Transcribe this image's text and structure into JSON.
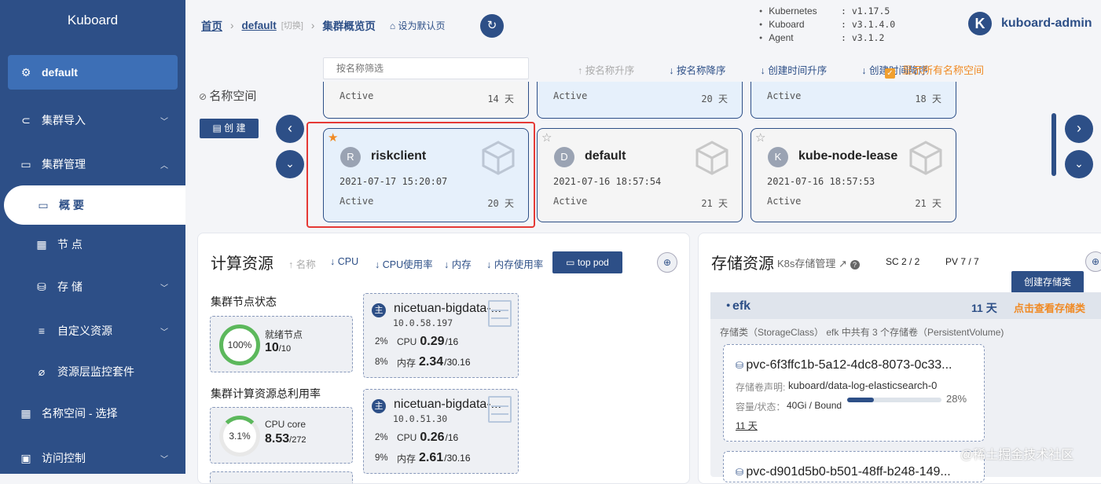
{
  "sidebar": {
    "brand": "Kuboard",
    "current_cluster": "default",
    "items": [
      {
        "label": "集群导入"
      },
      {
        "label": "集群管理"
      },
      {
        "label": "概 要"
      },
      {
        "label": "节 点"
      },
      {
        "label": "存 储"
      },
      {
        "label": "自定义资源"
      },
      {
        "label": "资源层监控套件"
      },
      {
        "label": "名称空间 - 选择"
      },
      {
        "label": "访问控制"
      }
    ]
  },
  "header": {
    "breadcrumb": {
      "home": "首页",
      "cluster": "default",
      "switch": "[切换]",
      "page": "集群概览页"
    },
    "set_default": "设为默认页",
    "versions": [
      {
        "name": "Kubernetes",
        "value": ": v1.17.5"
      },
      {
        "name": "Kuboard",
        "value": ": v3.1.4.0"
      },
      {
        "name": "Agent",
        "value": ": v3.1.2"
      }
    ],
    "user": {
      "initial": "K",
      "name": "kuboard-admin"
    }
  },
  "namespaces": {
    "label": "名称空间",
    "create_label": "创 建",
    "filter_placeholder": "按名称筛选",
    "sort": {
      "name_asc": "按名称升序",
      "name_desc": "按名称降序",
      "time_asc": "创建时间升序",
      "time_desc": "创建时间降序"
    },
    "show_all": "显示所有名称空间",
    "top_row": [
      {
        "status": "Active",
        "days": "14 天"
      },
      {
        "status": "Active",
        "days": "20 天"
      },
      {
        "status": "Active",
        "days": "18 天"
      }
    ],
    "cards": [
      {
        "initial": "R",
        "name": "riskclient",
        "created": "2021-07-17 15:20:07",
        "status": "Active",
        "days": "20 天",
        "starred": true
      },
      {
        "initial": "D",
        "name": "default",
        "created": "2021-07-16 18:57:54",
        "status": "Active",
        "days": "21 天",
        "starred": false
      },
      {
        "initial": "K",
        "name": "kube-node-lease",
        "created": "2021-07-16 18:57:53",
        "status": "Active",
        "days": "21 天",
        "starred": false
      }
    ]
  },
  "compute": {
    "title": "计算资源",
    "tabs": {
      "name": "名称",
      "cpu": "CPU",
      "cpu_usage": "CPU使用率",
      "mem": "内存",
      "mem_usage": "内存使用率"
    },
    "top_pod": "top pod",
    "node_status_title": "集群节点状态",
    "ready": {
      "pct": "100%",
      "label": "就绪节点",
      "value": "10",
      "total": "/10"
    },
    "usage_title": "集群计算资源总利用率",
    "cpu_core": {
      "pct": "3.1%",
      "label": "CPU core",
      "value": "8.53",
      "total": "/272"
    },
    "nodes": [
      {
        "initial": "主",
        "name": "nicetuan-bigdata-...",
        "ip": "10.0.58.197",
        "cpu_pct": "2%",
        "cpu_label": "CPU",
        "cpu": "0.29",
        "cpu_total": "/16",
        "mem_pct": "8%",
        "mem_label": "内存",
        "mem": "2.34",
        "mem_total": "/30.16"
      },
      {
        "initial": "主",
        "name": "nicetuan-bigdata-...",
        "ip": "10.0.51.30",
        "cpu_pct": "2%",
        "cpu_label": "CPU",
        "cpu": "0.26",
        "cpu_total": "/16",
        "mem_pct": "9%",
        "mem_label": "内存",
        "mem": "2.61",
        "mem_total": "/30.16"
      }
    ]
  },
  "storage": {
    "title": "存储资源",
    "subtitle": "K8s存储管理",
    "sc": "SC 2 / 2",
    "pv": "PV 7 / 7",
    "create": "创建存储类",
    "class": {
      "name": "efk",
      "days": "11 天",
      "link": "点击查看存储类",
      "desc": "存储类（StorageClass） efk 中共有 3 个存储卷（PersistentVolume)"
    },
    "pvs": [
      {
        "name": "pvc-6f3ffc1b-5a12-4dc8-8073-0c33...",
        "claim_label": "存储卷声明:",
        "claim": "kuboard/data-log-elasticsearch-0",
        "cap_label": "容量/状态：",
        "cap": "40Gi / Bound",
        "usage": "28%",
        "usage_fraction": 0.28,
        "days": "11 天"
      },
      {
        "name": "pvc-d901d5b0-b501-48ff-b248-149..."
      }
    ]
  },
  "watermark": "@稀土掘金技术社区"
}
